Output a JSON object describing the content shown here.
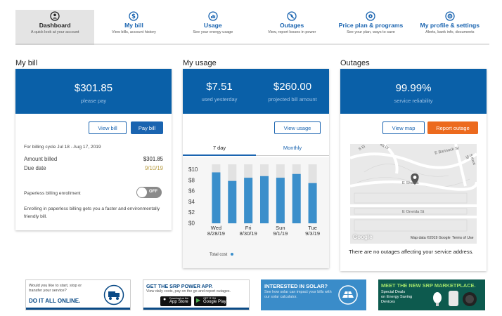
{
  "nav": [
    {
      "title": "Dashboard",
      "subtitle": "A quick look at your account",
      "icon": "dashboard-icon",
      "active": true
    },
    {
      "title": "My bill",
      "subtitle": "View bills, account history",
      "icon": "dollar-icon"
    },
    {
      "title": "Usage",
      "subtitle": "See your energy usage",
      "icon": "usage-chart-icon"
    },
    {
      "title": "Outages",
      "subtitle": "View, report losses in power",
      "icon": "outage-icon"
    },
    {
      "title": "Price plan & programs",
      "subtitle": "See your plan, ways to save",
      "icon": "price-plan-icon"
    },
    {
      "title": "My profile & settings",
      "subtitle": "Alerts, bank info, documents",
      "icon": "gear-icon"
    }
  ],
  "bill": {
    "section_title": "My bill",
    "amount": "$301.85",
    "amount_caption": "please pay",
    "view_bill": "View bill",
    "pay_bill": "Pay bill",
    "cycle": "For billing cycle Jul 18 - Aug 17, 2019",
    "amount_billed_label": "Amount billed",
    "amount_billed_value": "$301.85",
    "due_date_label": "Due date",
    "due_date_value": "9/10/19",
    "paperless_label": "Paperless billing enrollment",
    "toggle_label": "OFF",
    "paperless_note": "Enrolling in paperless billing gets you a faster and environmentally friendly bill."
  },
  "usage": {
    "section_title": "My usage",
    "yesterday_amount": "$7.51",
    "yesterday_caption": "used yesterday",
    "projected_amount": "$260.00",
    "projected_caption": "projected bill amount",
    "view_usage": "View usage",
    "tabs": [
      "7 day",
      "Monthly"
    ],
    "legend": "Total cost"
  },
  "outages": {
    "section_title": "Outages",
    "reliability": "99.99%",
    "reliability_caption": "service reliability",
    "view_map": "View map",
    "report_outage": "Report outage",
    "message": "There are no outages affecting your service address.",
    "map_streets": [
      "E Shasta",
      "E Bannock St",
      "E Oneida St",
      "S Kent St",
      "S El",
      "Kit Dr"
    ],
    "map_credit": "Map data ©2019 Google",
    "map_terms": "Terms of Use",
    "map_logo": "Google"
  },
  "chart_data": {
    "type": "bar",
    "categories": [
      "8/28/19",
      "8/29/19",
      "8/30/19",
      "8/31/19",
      "9/1/19",
      "9/2/19",
      "9/3/19"
    ],
    "tick_labels": [
      {
        "day": "Wed",
        "date": "8/28/19"
      },
      {
        "day": "Fri",
        "date": "8/30/19"
      },
      {
        "day": "Sun",
        "date": "9/1/19"
      },
      {
        "day": "Tue",
        "date": "9/3/19"
      }
    ],
    "values": [
      9.5,
      7.9,
      8.5,
      8.8,
      8.5,
      9.2,
      7.5
    ],
    "background_max": 11,
    "ylim": [
      0,
      11
    ],
    "yticks": [
      "$10",
      "$8",
      "$6",
      "$4",
      "$2",
      "$0"
    ],
    "ytick_values": [
      10,
      8,
      6,
      4,
      2,
      0
    ],
    "series": [
      {
        "name": "Total cost",
        "color": "#3b8fcb"
      }
    ]
  },
  "banners": {
    "b1": {
      "line1": "Would you like to start, stop or",
      "line2": "transfer your service?",
      "cta": "DO IT ALL ONLINE."
    },
    "b2": {
      "title": "GET THE SRP POWER APP.",
      "text": "View daily costs, pay on the go and report outages.",
      "app_store": "App Store",
      "app_store_small": "Download on the",
      "google_play": "Google Play",
      "google_play_small": "GET IT ON"
    },
    "b3": {
      "title": "INTERESTED IN SOLAR?",
      "text": "See how solar can impact your bills with our solar calculator."
    },
    "b4": {
      "title": "MEET THE NEW SRP MARKETPLACE.",
      "line1": "Special Deals",
      "line2": "on Energy Saving",
      "line3": "Devices"
    }
  },
  "colors": {
    "brand_blue": "#0a60a8",
    "link_blue": "#1a64b0",
    "orange": "#ec6a1e",
    "due_date": "#b79b40"
  }
}
